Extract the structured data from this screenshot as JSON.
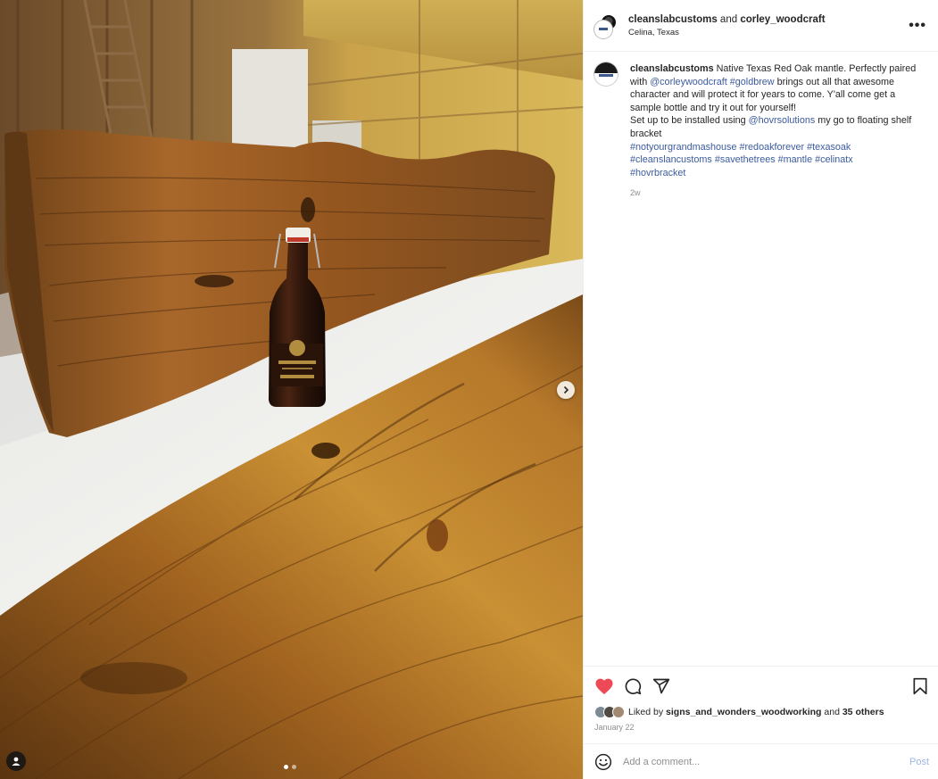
{
  "media": {
    "image_description_alt": "",
    "next_icon": "chevron-right-icon",
    "tag_icon": "user-tag-icon",
    "carousel": {
      "total": 2,
      "active": 1
    }
  },
  "header": {
    "owner": "cleanslabcustoms",
    "joiner": "and",
    "collaborator": "corley_woodcraft",
    "location": "Celina, Texas",
    "more_icon": "more-horizontal-icon",
    "more_label": "•••"
  },
  "caption": {
    "username": "cleanslabcustoms",
    "t1": " Native Texas Red Oak mantle. Perfectly paired with ",
    "mention1": "@corleywoodcraft",
    "t2": " ",
    "tag_goldbrew": "#goldbrew",
    "t3": " brings out all that awesome character and will protect it for years to come. Y'all come get a sample bottle and try it out for yourself!",
    "t4": "Set up to be installed using ",
    "mention2": "@hovrsolutions",
    "t5": " my go to floating shelf bracket",
    "hashtags": [
      "#notyourgrandmashouse",
      "#redoakforever",
      "#texasoak",
      "#cleanslancustoms",
      "#savethetrees",
      "#mantle",
      "#celinatx",
      "#hovrbracket"
    ],
    "time_ago": "2w"
  },
  "actions": {
    "like_icon": "heart-filled-icon",
    "comment_icon": "comment-icon",
    "share_icon": "share-icon",
    "save_icon": "bookmark-icon",
    "like_color": "#ed4956"
  },
  "likes": {
    "prefix": "Liked by ",
    "user": "signs_and_wonders_woodworking",
    "mid": " and ",
    "others": "35 others"
  },
  "date": "January 22",
  "comment": {
    "emoji_icon": "emoji-smile-icon",
    "placeholder": "Add a comment...",
    "post_label": "Post",
    "post_color": "#9cb6e8"
  }
}
